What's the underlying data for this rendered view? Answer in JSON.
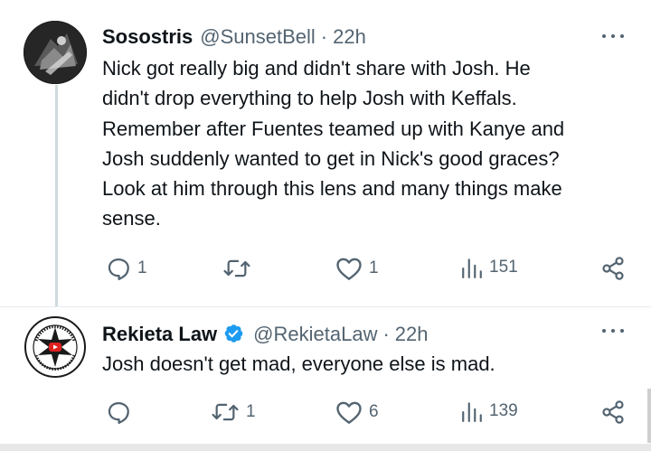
{
  "tweets": [
    {
      "name": "Sosostris",
      "handle": "@SunsetBell",
      "time": "22h",
      "text": "Nick got really big and didn't share with Josh. He\ndidn't drop everything to help Josh with Keffals.\nRemember after Fuentes teamed up with Kanye and\nJosh suddenly wanted to get in Nick's good graces?\nLook at him through this lens and many things make\nsense.",
      "replies": "1",
      "retweets": "",
      "likes": "1",
      "views": "151",
      "verified": false,
      "avatar_icon": "dark-photo-avatar"
    },
    {
      "name": "Rekieta Law",
      "handle": "@RekietaLaw",
      "time": "22h",
      "text": "Josh doesn't get mad, everyone else is mad.",
      "replies": "",
      "retweets": "1",
      "likes": "6",
      "views": "139",
      "verified": true,
      "avatar_icon": "lawyer-star-seal-avatar"
    }
  ],
  "colors": {
    "text": "#0f1419",
    "secondary": "#536471",
    "verified": "#1d9bf0",
    "thread_line": "#cfd9de"
  }
}
